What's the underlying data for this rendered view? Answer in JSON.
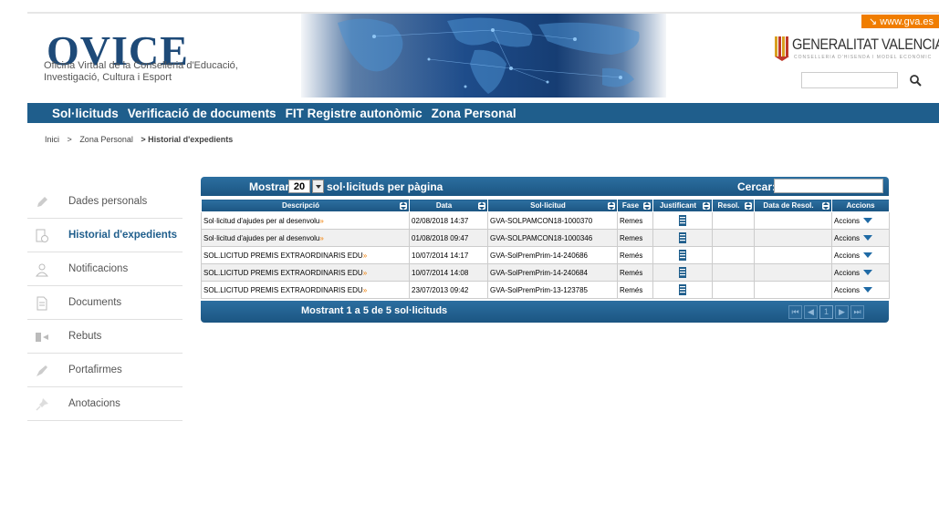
{
  "header": {
    "gva_link": "↘ www.gva.es",
    "logo_title": "OVICE",
    "logo_subtitle": "Oficina Virtual de la Conselleria d'Educació, Investigació, Cultura i Esport",
    "gv_name": "GENERALITAT VALENCIANA",
    "gv_sub": "CONSELLERIA D'HISENDA I MODEL ECONÒMIC",
    "search_placeholder": ""
  },
  "nav": {
    "items": [
      "Sol·licituds",
      "Verificació de documents",
      "FIT Registre autonòmic",
      "Zona Personal"
    ]
  },
  "breadcrumb": {
    "home": "Inici",
    "sep1": ">",
    "zone": "Zona Personal",
    "current": "> Historial d'expedients"
  },
  "sidebar": {
    "items": [
      {
        "label": "Dades personals",
        "icon": "pencil-icon"
      },
      {
        "label": "Historial d'expedients",
        "icon": "history-icon",
        "active": true
      },
      {
        "label": "Notificacions",
        "icon": "user-icon"
      },
      {
        "label": "Documents",
        "icon": "document-icon"
      },
      {
        "label": "Rebuts",
        "icon": "receipt-icon"
      },
      {
        "label": "Portafirmes",
        "icon": "pen-icon"
      },
      {
        "label": "Anotacions",
        "icon": "pin-icon"
      }
    ]
  },
  "table": {
    "show_label": "Mostrar",
    "page_length": "20",
    "page_length_suffix": "sol·licituds per pàgina",
    "search_label": "Cercar:",
    "search_value": "",
    "columns": [
      "Descripció",
      "Data",
      "Sol·licitud",
      "Fase",
      "Justificant",
      "Resol.",
      "Data de Resol.",
      "Accions"
    ],
    "rows": [
      {
        "desc": "Sol·licitud d'ajudes per al desenvolu",
        "data": "02/08/2018 14:37",
        "sol": "GVA-SOLPAMCON18-1000370",
        "fase": "Remes",
        "resol": "",
        "data_resol": "",
        "accions": "Accions"
      },
      {
        "desc": "Sol·licitud d'ajudes per al desenvolu",
        "data": "01/08/2018 09:47",
        "sol": "GVA-SOLPAMCON18-1000346",
        "fase": "Remes",
        "resol": "",
        "data_resol": "",
        "accions": "Accions"
      },
      {
        "desc": "SOL.LICITUD PREMIS EXTRAORDINARIS EDU",
        "data": "10/07/2014 14:17",
        "sol": "GVA-SolPremPrim-14-240686",
        "fase": "Remés",
        "resol": "",
        "data_resol": "",
        "accions": "Accions"
      },
      {
        "desc": "SOL.LICITUD PREMIS EXTRAORDINARIS EDU",
        "data": "10/07/2014 14:08",
        "sol": "GVA-SolPremPrim-14-240684",
        "fase": "Remés",
        "resol": "",
        "data_resol": "",
        "accions": "Accions"
      },
      {
        "desc": "SOL.LICITUD PREMIS EXTRAORDINARIS EDU",
        "data": "23/07/2013 09:42",
        "sol": "GVA-SolPremPrim-13-123785",
        "fase": "Remés",
        "resol": "",
        "data_resol": "",
        "accions": "Accions"
      }
    ],
    "more_glyph": "»",
    "footer_info": "Mostrant 1 a 5 de 5 sol·licituds",
    "pager": [
      "⏮",
      "◀",
      "1",
      "▶",
      "⏭"
    ]
  },
  "colors": {
    "nav": "#1f5e8c",
    "accent": "#f07d00",
    "logo": "#1e4a78"
  }
}
